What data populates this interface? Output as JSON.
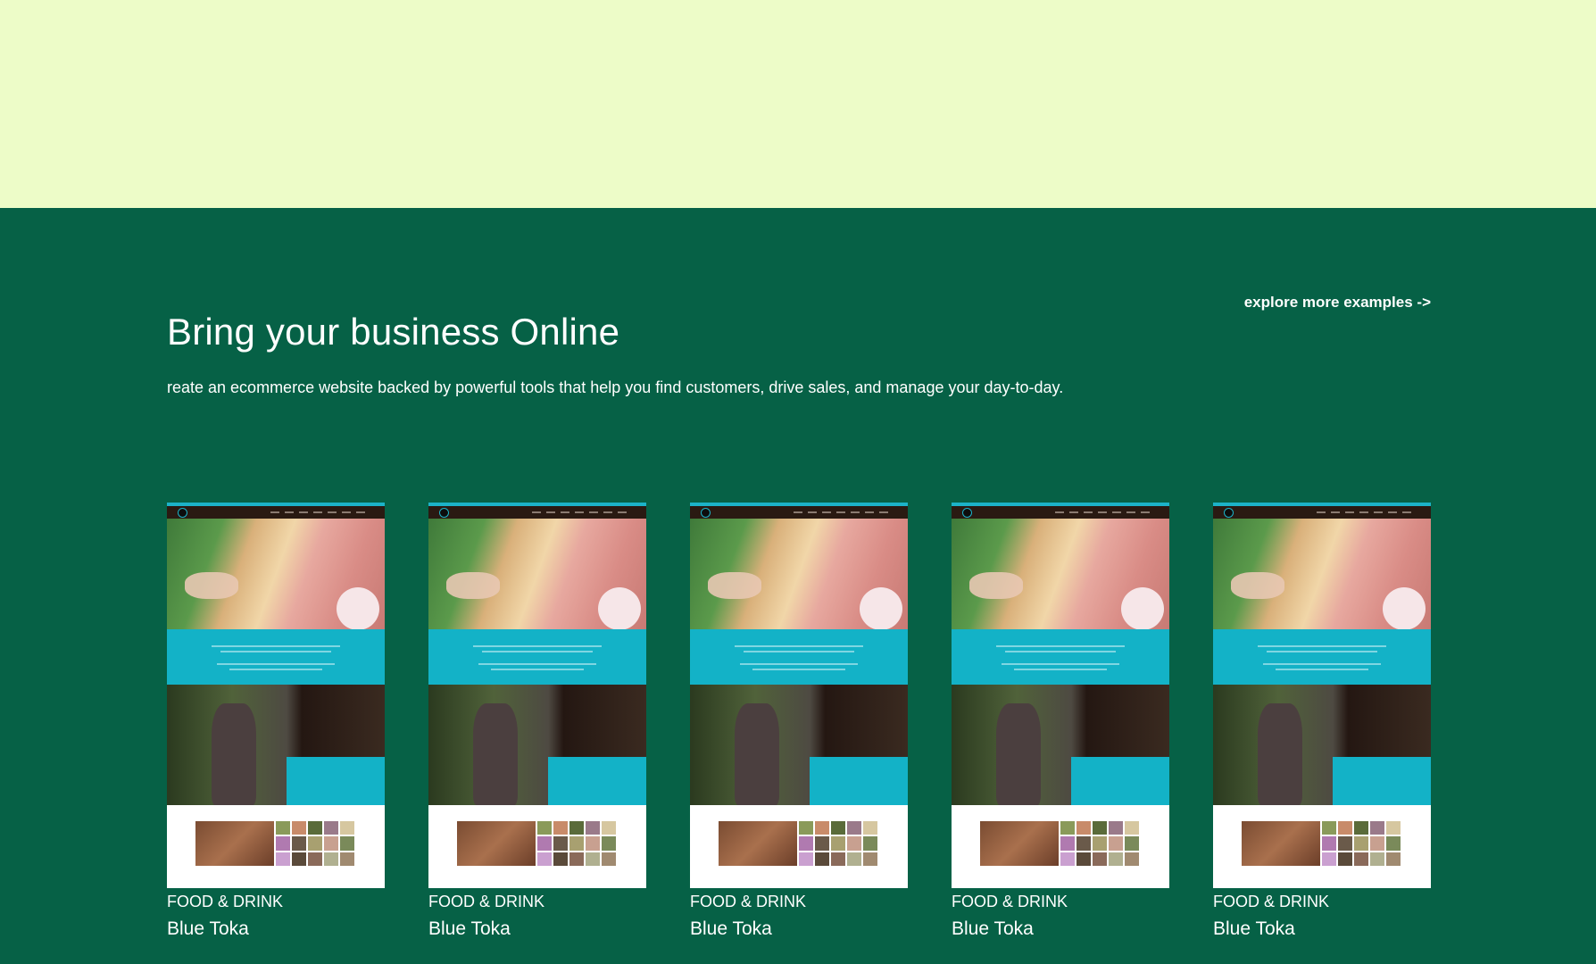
{
  "section": {
    "heading": "Bring your business Online",
    "subtitle": "reate an ecommerce website backed by powerful tools that help you find customers, drive sales, and manage your day-to-day.",
    "explore_link": "explore more examples ->"
  },
  "examples": [
    {
      "category": "FOOD & DRINK",
      "name": "Blue Toka"
    },
    {
      "category": "FOOD & DRINK",
      "name": "Blue Toka"
    },
    {
      "category": "FOOD & DRINK",
      "name": "Blue Toka"
    },
    {
      "category": "FOOD & DRINK",
      "name": "Blue Toka"
    },
    {
      "category": "FOOD & DRINK",
      "name": "Blue Toka"
    }
  ],
  "colors": {
    "top_band": "#edfcc8",
    "section_bg": "#066146",
    "accent_teal": "#13b2c7"
  }
}
